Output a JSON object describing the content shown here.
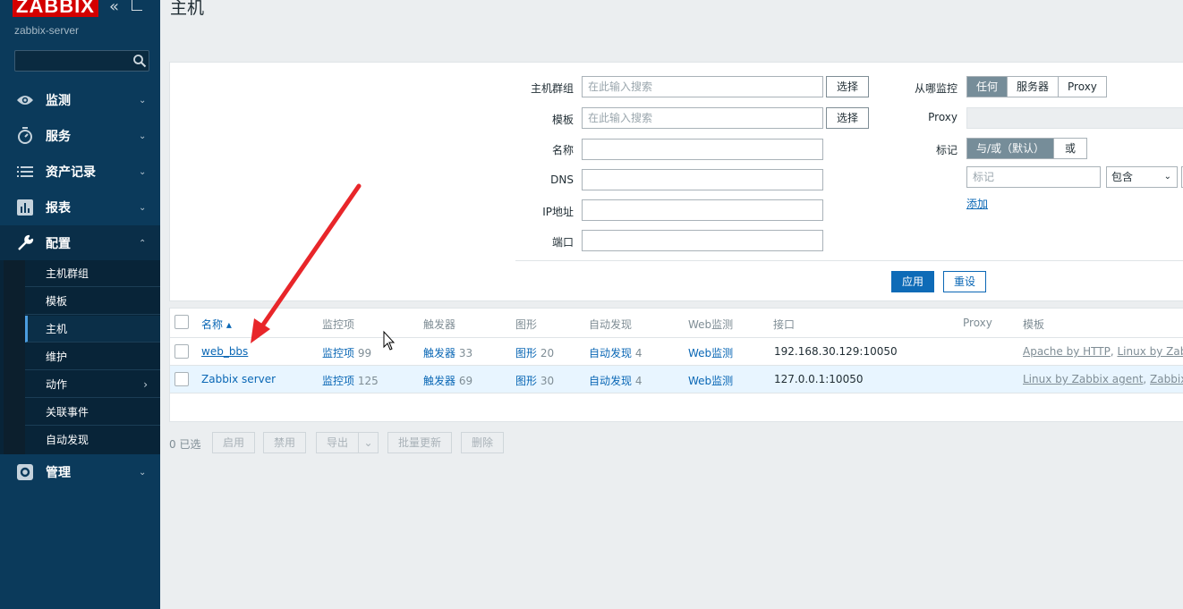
{
  "app": {
    "logo": "ZABBIX",
    "server_name": "zabbix-server",
    "page_title": "主机"
  },
  "sidebar": {
    "items": [
      {
        "label": "监测",
        "icon": "eye-icon"
      },
      {
        "label": "服务",
        "icon": "stopwatch-icon"
      },
      {
        "label": "资产记录",
        "icon": "list-icon"
      },
      {
        "label": "报表",
        "icon": "bar-chart-icon"
      },
      {
        "label": "配置",
        "icon": "wrench-icon"
      },
      {
        "label": "管理",
        "icon": "gear-icon"
      }
    ],
    "submenu": [
      {
        "label": "主机群组"
      },
      {
        "label": "模板"
      },
      {
        "label": "主机"
      },
      {
        "label": "维护"
      },
      {
        "label": "动作"
      },
      {
        "label": "关联事件"
      },
      {
        "label": "自动发现"
      }
    ]
  },
  "filter": {
    "host_groups_label": "主机群组",
    "templates_label": "模板",
    "name_label": "名称",
    "dns_label": "DNS",
    "ip_label": "IP地址",
    "port_label": "端口",
    "search_placeholder": "在此输入搜索",
    "select_label": "选择",
    "monitored_by_label": "从哪监控",
    "monitored_by_options": [
      "任何",
      "服务器",
      "Proxy"
    ],
    "proxy_label": "Proxy",
    "tags_label": "标记",
    "tags_options": [
      "与/或（默认）",
      "或"
    ],
    "tag_placeholder": "标记",
    "tag_operator": "包含",
    "add_label": "添加",
    "apply_label": "应用",
    "reset_label": "重设"
  },
  "table": {
    "headers": {
      "name": "名称 ▴",
      "items": "监控项",
      "triggers": "触发器",
      "graphs": "图形",
      "discovery": "自动发现",
      "web": "Web监测",
      "interface": "接口",
      "proxy": "Proxy",
      "templates": "模板"
    },
    "rows": [
      {
        "name": "web_bbs",
        "items_label": "监控项",
        "items_count": "99",
        "triggers_label": "触发器",
        "triggers_count": "33",
        "graphs_label": "图形",
        "graphs_count": "20",
        "discovery_label": "自动发现",
        "discovery_count": "4",
        "web": "Web监测",
        "interface": "192.168.30.129:10050",
        "template_1": "Apache by HTTP",
        "template_sep": ", ",
        "template_2": "Linux by Zabbix"
      },
      {
        "name": "Zabbix server",
        "items_label": "监控项",
        "items_count": "125",
        "triggers_label": "触发器",
        "triggers_count": "69",
        "graphs_label": "图形",
        "graphs_count": "30",
        "discovery_label": "自动发现",
        "discovery_count": "4",
        "web": "Web监测",
        "interface": "127.0.0.1:10050",
        "template_1": "Linux by Zabbix agent",
        "template_sep": ", ",
        "template_2": "Zabbix ser"
      }
    ]
  },
  "footer": {
    "selected": "0 已选",
    "enable": "启用",
    "disable": "禁用",
    "export": "导出",
    "mass_update": "批量更新",
    "delete": "删除"
  },
  "colors": {
    "sidebar_bg": "#0b3a5b",
    "accent_blue": "#0e6bb7",
    "logo_red": "#d40000",
    "annotation_arrow": "#e8262a"
  }
}
